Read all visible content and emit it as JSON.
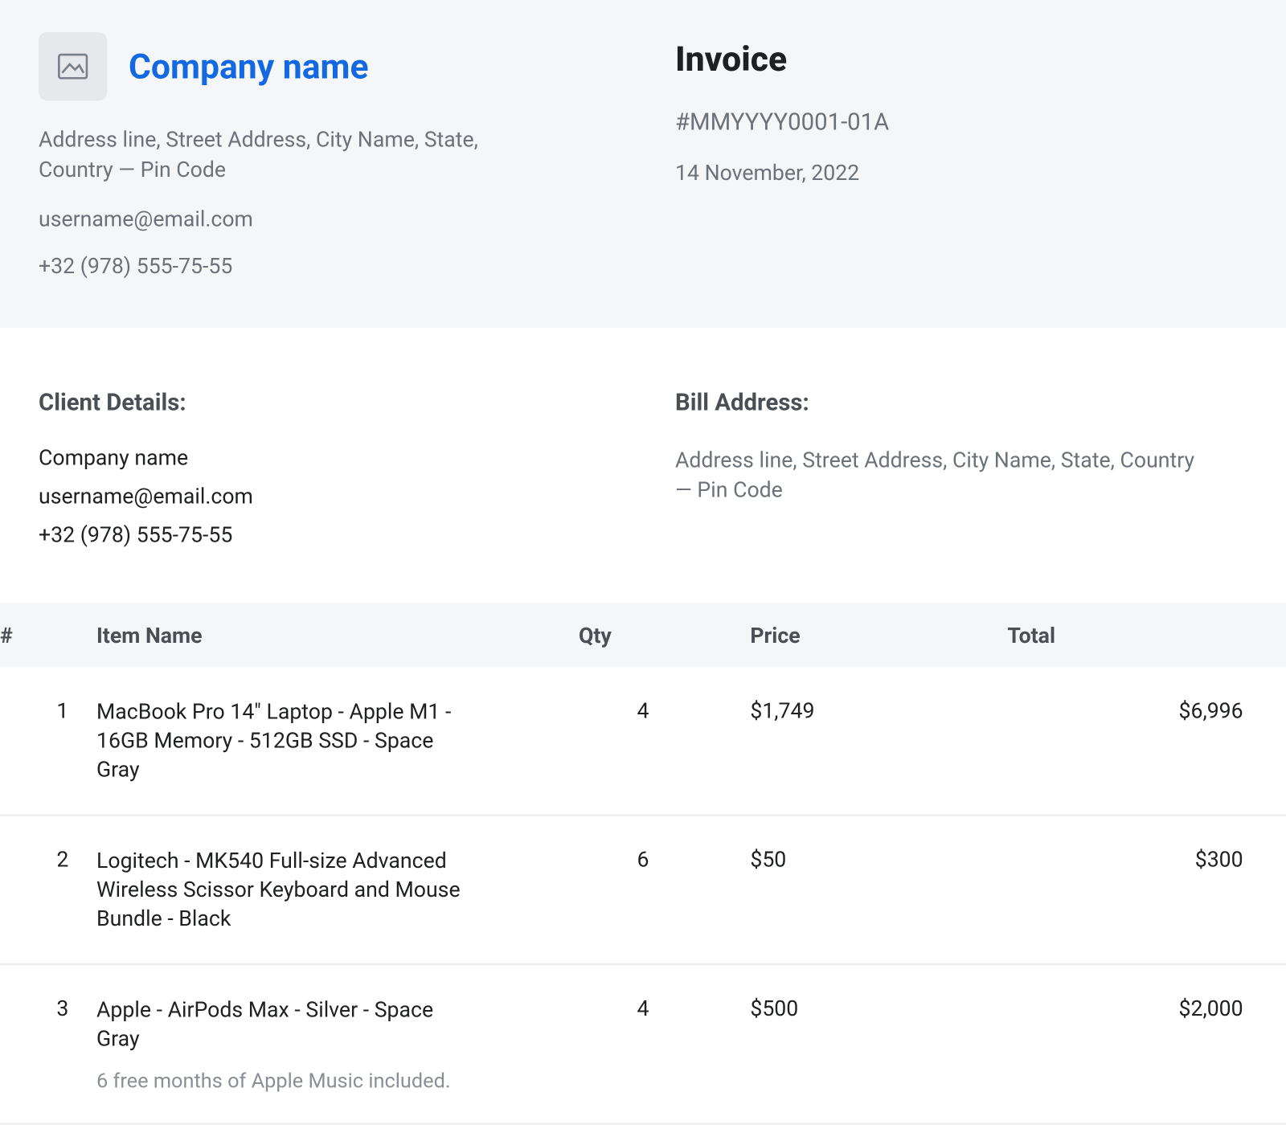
{
  "header": {
    "company_name": "Company name",
    "address": "Address line, Street Address, City Name, State, Country — Pin Code",
    "email": "username@email.com",
    "phone": "+32 (978) 555-75-55",
    "invoice_title": "Invoice",
    "invoice_number": "#MMYYYY0001-01A",
    "invoice_date": "14 November, 2022"
  },
  "client": {
    "section_title": "Client Details:",
    "company": "Company name",
    "email": "username@email.com",
    "phone": "+32 (978) 555-75-55"
  },
  "billing": {
    "section_title": "Bill Address:",
    "address": "Address line, Street Address, City Name, State, Country — Pin Code"
  },
  "table": {
    "headers": {
      "idx": "#",
      "name": "Item Name",
      "qty": "Qty",
      "price": "Price",
      "total": "Total"
    },
    "rows": [
      {
        "idx": "1",
        "name": "MacBook Pro 14\" Laptop - Apple M1  - 16GB Memory - 512GB SSD - Space Gray",
        "note": "",
        "qty": "4",
        "price": "$1,749",
        "total": "$6,996"
      },
      {
        "idx": "2",
        "name": "Logitech - MK540 Full-size Advanced Wireless Scissor Keyboard and Mouse Bundle - Black",
        "note": "",
        "qty": "6",
        "price": "$50",
        "total": "$300"
      },
      {
        "idx": "3",
        "name": "Apple - AirPods Max - Silver - Space Gray",
        "note": "6 free months of Apple Music included.",
        "qty": "4",
        "price": "$500",
        "total": "$2,000"
      }
    ]
  }
}
